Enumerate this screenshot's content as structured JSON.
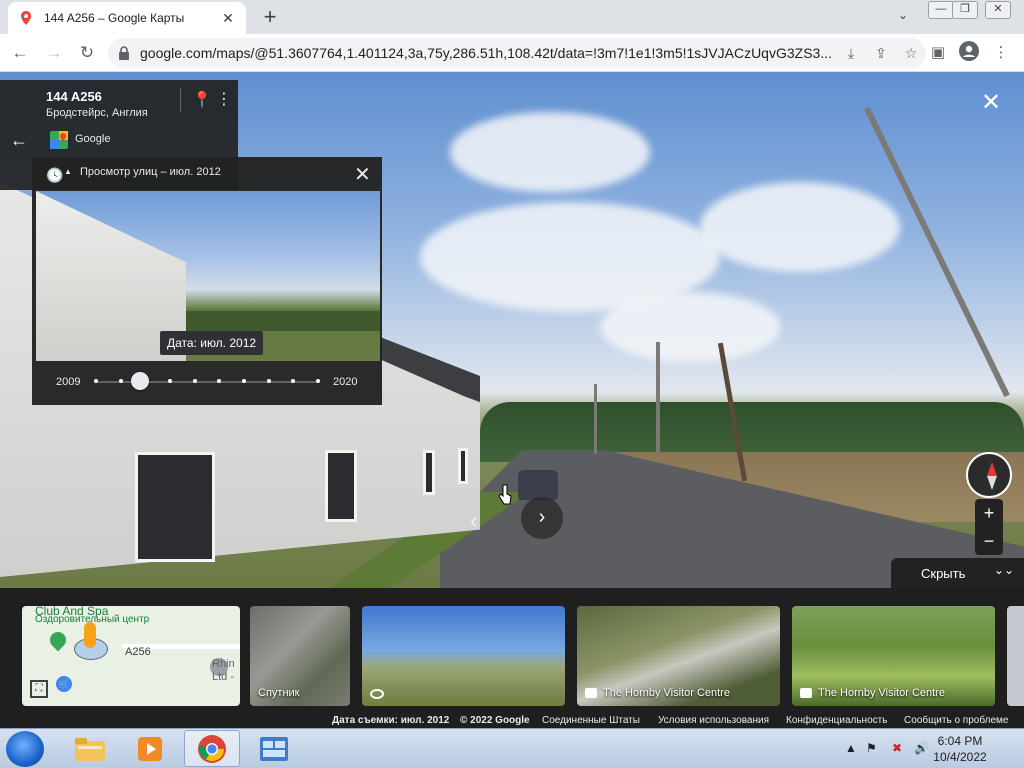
{
  "browser": {
    "tab_title": "144 A256 – Google Карты",
    "url": "google.com/maps/@51.3607764,1.401124,3a,75y,286.51h,108.42t/data=!3m7!1e1!3m5!1sJVJACzUqvG3ZS3...",
    "new_tab_label": "+",
    "tab_close": "✕",
    "minimize": "—",
    "restore": "❐",
    "close": "✕"
  },
  "place": {
    "title": "144 A256",
    "subtitle": "Бродстейрс, Англия",
    "source": "Google"
  },
  "timeline": {
    "title": "Просмотр улиц – июл. 2012",
    "date_badge": "Дата: июл. 2012",
    "start_year": "2009",
    "end_year": "2020",
    "dot_count": 10,
    "selected_index": 1
  },
  "controls": {
    "hide_label": "Скрыть"
  },
  "filmstrip": {
    "map": {
      "title": "Club And Spa",
      "subtitle": "Оздоровительный центр",
      "road": "A256",
      "poi": "Rhin Ltd -"
    },
    "cards": [
      {
        "label": "Спутник",
        "type": "satellite"
      },
      {
        "label": "",
        "type": "photosphere"
      },
      {
        "label": "The Hornby Visitor Centre",
        "type": "photo"
      },
      {
        "label": "The Hornby Visitor Centre",
        "type": "photo"
      }
    ]
  },
  "footer": {
    "capture_date": "Дата съемки: июл. 2012",
    "copyright": "© 2022 Google",
    "region": "Соединенные Штаты",
    "terms": "Условия использования",
    "privacy": "Конфиденциальность",
    "report": "Сообщить о проблеме"
  },
  "taskbar": {
    "time": "6:04 PM",
    "date": "10/4/2022"
  }
}
